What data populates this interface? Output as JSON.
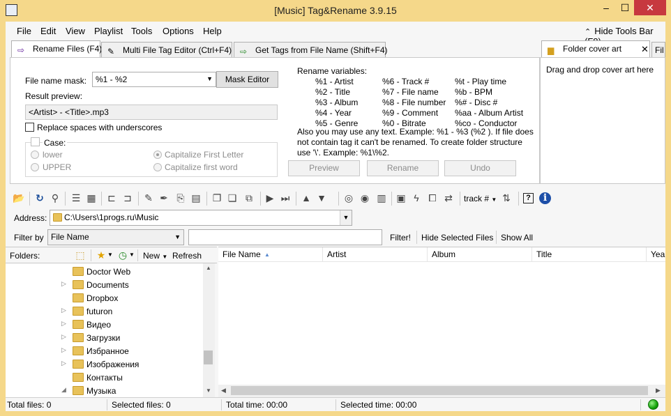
{
  "window": {
    "title": "[Music] Tag&Rename 3.9.15",
    "minimize": "–",
    "maximize": "☐",
    "close": "✕"
  },
  "menu": {
    "file": "File",
    "edit": "Edit",
    "view": "View",
    "playlist": "Playlist",
    "tools": "Tools",
    "options": "Options",
    "help": "Help",
    "hide_tools": "Hide Tools Bar (F8)"
  },
  "tabs": {
    "rename": "Rename Files (F4)",
    "multi": "Multi File Tag Editor (Ctrl+F4)",
    "get_tags": "Get Tags from File Name (Shift+F4)",
    "cover": "Folder cover art",
    "cover_trunc": "Fil"
  },
  "rename": {
    "mask_label": "File name mask:",
    "mask_value": "%1 - %2",
    "mask_editor": "Mask Editor",
    "result_label": "Result preview:",
    "result_value": "<Artist> - <Title>.mp3",
    "replace_spaces": "Replace spaces with underscores",
    "case_label": "Case:",
    "lower": "lower",
    "upper": "UPPER",
    "capitalize_first_letter": "Capitalize First Letter",
    "capitalize_first_word": "Capitalize first word",
    "vars_title": "Rename variables:",
    "vars": [
      [
        "%1 - Artist",
        "%6 - Track #",
        "%t - Play time"
      ],
      [
        "%2 - Title",
        "%7 - File name",
        "%b - BPM"
      ],
      [
        "%3 - Album",
        "%8 - File number",
        "%# - Disc #"
      ],
      [
        "%4 - Year",
        "%9 - Comment",
        "%aa - Album Artist"
      ],
      [
        "%5 - Genre",
        "%0 - Bitrate",
        "%co - Conductor"
      ]
    ],
    "note_1": "Also you may use any text. Example: %1 - %3 (%2 ). If file does",
    "note_2": "not contain tag it can't be renamed. To create folder structure",
    "note_3": "use '\\'. Example: %1\\%2.",
    "preview": "Preview",
    "rename_btn": "Rename",
    "undo": "Undo"
  },
  "cover": {
    "hint": "Drag and drop cover art here"
  },
  "toolbar": {
    "track_label": "track #"
  },
  "address": {
    "label": "Address:",
    "value": "C:\\Users\\1progs.ru\\Music"
  },
  "filter": {
    "label": "Filter by",
    "field": "File Name",
    "filter_btn": "Filter!",
    "hide_selected": "Hide Selected Files",
    "show_all": "Show All"
  },
  "folders": {
    "title": "Folders:",
    "new": "New",
    "refresh": "Refresh",
    "items": [
      "Doctor Web",
      "Documents",
      "Dropbox",
      "futuron",
      "Видео",
      "Загрузки",
      "Избранное",
      "Изображения",
      "Контакты",
      "Музыка"
    ]
  },
  "columns": [
    "File Name",
    "Artist",
    "Album",
    "Title",
    "Yea"
  ],
  "status": {
    "total_files": "Total files: 0",
    "selected_files": "Selected files: 0",
    "total_time": "Total time: 00:00",
    "selected_time": "Selected time: 00:00"
  }
}
